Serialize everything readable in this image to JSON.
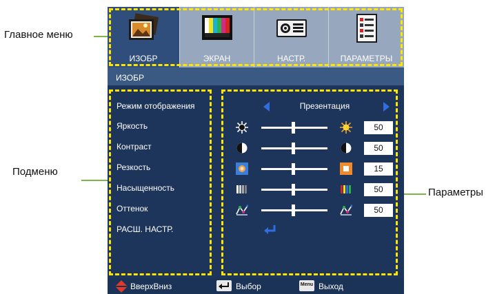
{
  "callouts": {
    "main_menu": "Главное меню",
    "submenu": "Подменю",
    "params": "Параметры"
  },
  "tabs": [
    {
      "label": "ИЗОБР",
      "icon": "picture-icon",
      "active": true
    },
    {
      "label": "ЭКРАН",
      "icon": "color-bars-icon",
      "active": false
    },
    {
      "label": "НАСТР.",
      "icon": "projector-icon",
      "active": false
    },
    {
      "label": "ПАРАМЕТРЫ",
      "icon": "checklist-icon",
      "active": false
    }
  ],
  "section_title": "ИЗОБР",
  "submenu_items": [
    "Режим отображения",
    "Яркость",
    "Контраст",
    "Резкость",
    "Насыщенность",
    "Оттенок",
    "РАСШ. НАСТР."
  ],
  "display_mode": "Презентация",
  "settings": [
    {
      "name": "brightness",
      "left_icon": "sun-dark-icon",
      "right_icon": "sun-bright-icon",
      "value": "50"
    },
    {
      "name": "contrast",
      "left_icon": "contrast-icon",
      "right_icon": "contrast-icon",
      "value": "50"
    },
    {
      "name": "sharpness",
      "left_icon": "sharpness-low-icon",
      "right_icon": "sharpness-high-icon",
      "value": "15"
    },
    {
      "name": "saturation",
      "left_icon": "saturation-low-icon",
      "right_icon": "saturation-high-icon",
      "value": "50"
    },
    {
      "name": "tint",
      "left_icon": "tint-icon",
      "right_icon": "tint-icon",
      "value": "50"
    }
  ],
  "footer": {
    "updown": "ВверхВниз",
    "select": "Выбор",
    "menu_key": "Menu",
    "exit": "Выход"
  },
  "colors": {
    "accent_yellow": "#ffe600",
    "callout_green": "#7ab648",
    "panel_dark": "#1e355b",
    "header_blue": "#3b5a83"
  }
}
